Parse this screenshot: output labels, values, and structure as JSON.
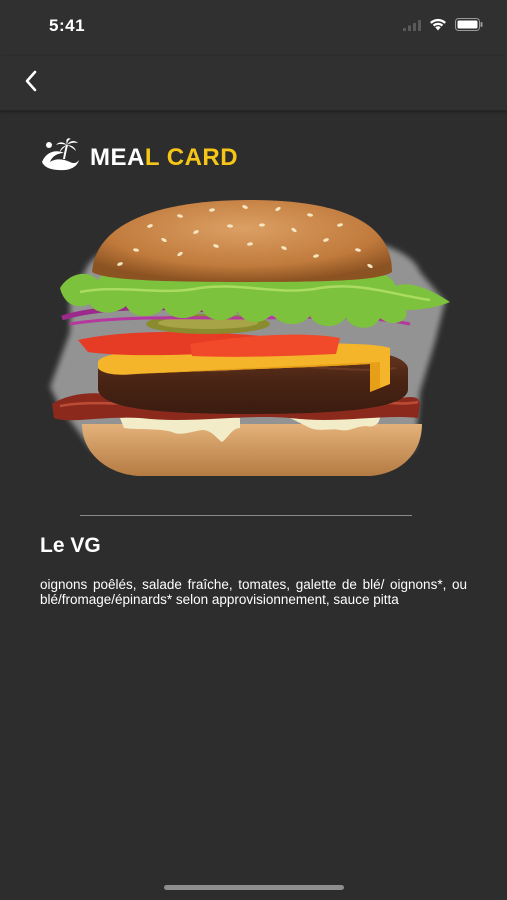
{
  "status_bar": {
    "time": "5:41",
    "icons": [
      "signal-icon",
      "wifi-icon",
      "battery-icon"
    ]
  },
  "nav": {
    "back_icon": "chevron-left-icon"
  },
  "brand": {
    "logo_icon": "palm-wave-logo-icon",
    "text_part_1": "MEA",
    "text_part_2": "L CARD",
    "accent_color": "#f5c518"
  },
  "item": {
    "image": "burger-photo",
    "title": "Le VG",
    "description": "oignons poêlés, salade fraîche, tomates, galette de blé/ oignons*, ou blé/fromage/épinards* selon approvisionnement, sauce pitta"
  },
  "colors": {
    "background": "#2d2d2d",
    "bar": "#303030",
    "text": "#ffffff"
  }
}
